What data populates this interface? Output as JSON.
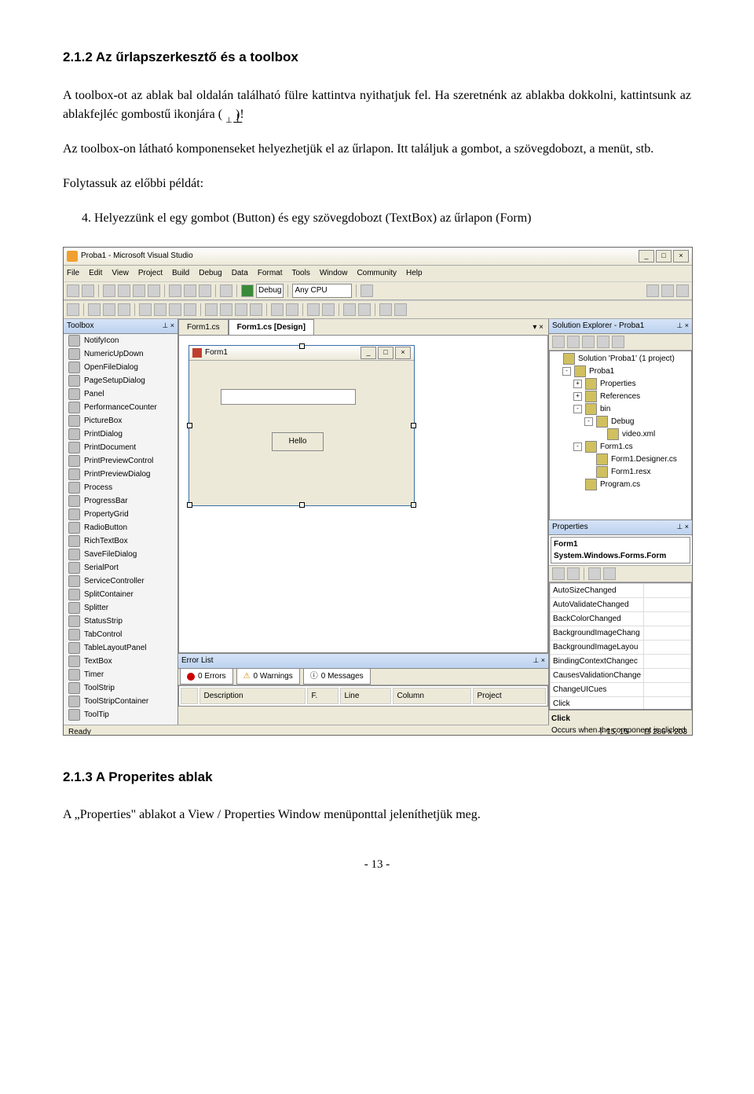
{
  "headings": {
    "section1": "2.1.2  Az űrlapszerkesztő és a toolbox",
    "section2": "2.1.3  A Properites ablak"
  },
  "paragraphs": {
    "p1a": "A toolbox-ot az ablak bal oldalán található fülre kattintva nyithatjuk fel. Ha szeretnénk az ablakba dokkolni, kattintsunk az ablakfejléc gombostű ikonjára (",
    "p1b": ")!",
    "p2": "Az toolbox-on látható komponenseket helyezhetjük el az űrlapon. Itt találjuk a gombot, a szövegdobozt, a menüt, stb.",
    "p3": "Folytassuk az előbbi példát:",
    "li1": "Helyezzünk el egy gombot (Button) és egy szövegdobozt (TextBox) az űrlapon (Form)",
    "p4": "A „Properties\" ablakot a View / Properties Window menüponttal jeleníthetjük meg."
  },
  "vs": {
    "title": "Proba1 - Microsoft Visual Studio",
    "menus": [
      "File",
      "Edit",
      "View",
      "Project",
      "Build",
      "Debug",
      "Data",
      "Format",
      "Tools",
      "Window",
      "Community",
      "Help"
    ],
    "debug_mode": "Debug",
    "platform": "Any CPU",
    "toolbox": {
      "title": "Toolbox",
      "items": [
        "NotifyIcon",
        "NumericUpDown",
        "OpenFileDialog",
        "PageSetupDialog",
        "Panel",
        "PerformanceCounter",
        "PictureBox",
        "PrintDialog",
        "PrintDocument",
        "PrintPreviewControl",
        "PrintPreviewDialog",
        "Process",
        "ProgressBar",
        "PropertyGrid",
        "RadioButton",
        "RichTextBox",
        "SaveFileDialog",
        "SerialPort",
        "ServiceController",
        "SplitContainer",
        "Splitter",
        "StatusStrip",
        "TabControl",
        "TableLayoutPanel",
        "TextBox",
        "Timer",
        "ToolStrip",
        "ToolStripContainer",
        "ToolTip"
      ]
    },
    "doc_tabs": [
      "Form1.cs",
      "Form1.cs [Design]"
    ],
    "form_title": "Form1",
    "button_text": "Hello",
    "errorlist": {
      "title": "Error List",
      "errors": "0 Errors",
      "warnings": "0 Warnings",
      "messages": "0 Messages",
      "columns": [
        "",
        "Description",
        "F.",
        "Line",
        "Column",
        "Project"
      ]
    },
    "solution": {
      "title": "Solution Explorer - Proba1",
      "root": "Solution 'Proba1' (1 project)",
      "project": "Proba1",
      "nodes": [
        "Properties",
        "References",
        "bin",
        "Debug",
        "video.xml",
        "Form1.cs",
        "Form1.Designer.cs",
        "Form1.resx",
        "Program.cs"
      ]
    },
    "props": {
      "title": "Properties",
      "object": "Form1 System.Windows.Forms.Form",
      "rows": [
        "AutoSizeChanged",
        "AutoValidateChanged",
        "BackColorChanged",
        "BackgroundImageChang",
        "BackgroundImageLayou",
        "BindingContextChangec",
        "CausesValidationChange",
        "ChangeUICues",
        "Click"
      ],
      "desc_title": "Click",
      "desc_text": "Occurs when the component is clicked."
    },
    "status_ready": "Ready",
    "status_pos": "15, 15",
    "status_size": "286 x 203"
  },
  "page_number": "- 13 -"
}
